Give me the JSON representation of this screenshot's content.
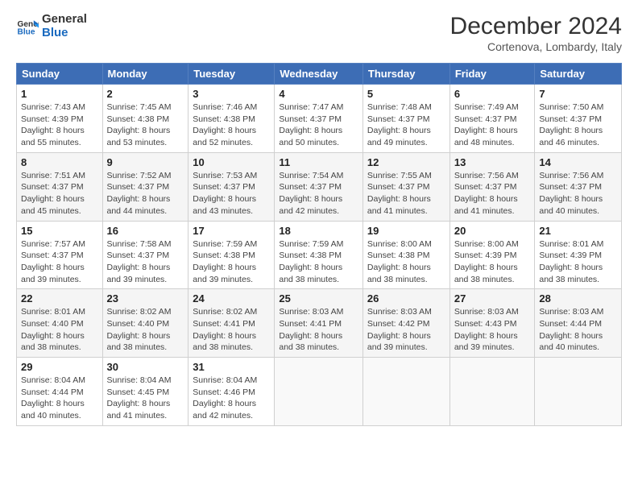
{
  "logo": {
    "line1": "General",
    "line2": "Blue"
  },
  "header": {
    "month_year": "December 2024",
    "location": "Cortenova, Lombardy, Italy"
  },
  "weekdays": [
    "Sunday",
    "Monday",
    "Tuesday",
    "Wednesday",
    "Thursday",
    "Friday",
    "Saturday"
  ],
  "weeks": [
    [
      {
        "day": "1",
        "info": "Sunrise: 7:43 AM\nSunset: 4:39 PM\nDaylight: 8 hours\nand 55 minutes."
      },
      {
        "day": "2",
        "info": "Sunrise: 7:45 AM\nSunset: 4:38 PM\nDaylight: 8 hours\nand 53 minutes."
      },
      {
        "day": "3",
        "info": "Sunrise: 7:46 AM\nSunset: 4:38 PM\nDaylight: 8 hours\nand 52 minutes."
      },
      {
        "day": "4",
        "info": "Sunrise: 7:47 AM\nSunset: 4:37 PM\nDaylight: 8 hours\nand 50 minutes."
      },
      {
        "day": "5",
        "info": "Sunrise: 7:48 AM\nSunset: 4:37 PM\nDaylight: 8 hours\nand 49 minutes."
      },
      {
        "day": "6",
        "info": "Sunrise: 7:49 AM\nSunset: 4:37 PM\nDaylight: 8 hours\nand 48 minutes."
      },
      {
        "day": "7",
        "info": "Sunrise: 7:50 AM\nSunset: 4:37 PM\nDaylight: 8 hours\nand 46 minutes."
      }
    ],
    [
      {
        "day": "8",
        "info": "Sunrise: 7:51 AM\nSunset: 4:37 PM\nDaylight: 8 hours\nand 45 minutes."
      },
      {
        "day": "9",
        "info": "Sunrise: 7:52 AM\nSunset: 4:37 PM\nDaylight: 8 hours\nand 44 minutes."
      },
      {
        "day": "10",
        "info": "Sunrise: 7:53 AM\nSunset: 4:37 PM\nDaylight: 8 hours\nand 43 minutes."
      },
      {
        "day": "11",
        "info": "Sunrise: 7:54 AM\nSunset: 4:37 PM\nDaylight: 8 hours\nand 42 minutes."
      },
      {
        "day": "12",
        "info": "Sunrise: 7:55 AM\nSunset: 4:37 PM\nDaylight: 8 hours\nand 41 minutes."
      },
      {
        "day": "13",
        "info": "Sunrise: 7:56 AM\nSunset: 4:37 PM\nDaylight: 8 hours\nand 41 minutes."
      },
      {
        "day": "14",
        "info": "Sunrise: 7:56 AM\nSunset: 4:37 PM\nDaylight: 8 hours\nand 40 minutes."
      }
    ],
    [
      {
        "day": "15",
        "info": "Sunrise: 7:57 AM\nSunset: 4:37 PM\nDaylight: 8 hours\nand 39 minutes."
      },
      {
        "day": "16",
        "info": "Sunrise: 7:58 AM\nSunset: 4:37 PM\nDaylight: 8 hours\nand 39 minutes."
      },
      {
        "day": "17",
        "info": "Sunrise: 7:59 AM\nSunset: 4:38 PM\nDaylight: 8 hours\nand 39 minutes."
      },
      {
        "day": "18",
        "info": "Sunrise: 7:59 AM\nSunset: 4:38 PM\nDaylight: 8 hours\nand 38 minutes."
      },
      {
        "day": "19",
        "info": "Sunrise: 8:00 AM\nSunset: 4:38 PM\nDaylight: 8 hours\nand 38 minutes."
      },
      {
        "day": "20",
        "info": "Sunrise: 8:00 AM\nSunset: 4:39 PM\nDaylight: 8 hours\nand 38 minutes."
      },
      {
        "day": "21",
        "info": "Sunrise: 8:01 AM\nSunset: 4:39 PM\nDaylight: 8 hours\nand 38 minutes."
      }
    ],
    [
      {
        "day": "22",
        "info": "Sunrise: 8:01 AM\nSunset: 4:40 PM\nDaylight: 8 hours\nand 38 minutes."
      },
      {
        "day": "23",
        "info": "Sunrise: 8:02 AM\nSunset: 4:40 PM\nDaylight: 8 hours\nand 38 minutes."
      },
      {
        "day": "24",
        "info": "Sunrise: 8:02 AM\nSunset: 4:41 PM\nDaylight: 8 hours\nand 38 minutes."
      },
      {
        "day": "25",
        "info": "Sunrise: 8:03 AM\nSunset: 4:41 PM\nDaylight: 8 hours\nand 38 minutes."
      },
      {
        "day": "26",
        "info": "Sunrise: 8:03 AM\nSunset: 4:42 PM\nDaylight: 8 hours\nand 39 minutes."
      },
      {
        "day": "27",
        "info": "Sunrise: 8:03 AM\nSunset: 4:43 PM\nDaylight: 8 hours\nand 39 minutes."
      },
      {
        "day": "28",
        "info": "Sunrise: 8:03 AM\nSunset: 4:44 PM\nDaylight: 8 hours\nand 40 minutes."
      }
    ],
    [
      {
        "day": "29",
        "info": "Sunrise: 8:04 AM\nSunset: 4:44 PM\nDaylight: 8 hours\nand 40 minutes."
      },
      {
        "day": "30",
        "info": "Sunrise: 8:04 AM\nSunset: 4:45 PM\nDaylight: 8 hours\nand 41 minutes."
      },
      {
        "day": "31",
        "info": "Sunrise: 8:04 AM\nSunset: 4:46 PM\nDaylight: 8 hours\nand 42 minutes."
      },
      null,
      null,
      null,
      null
    ]
  ]
}
